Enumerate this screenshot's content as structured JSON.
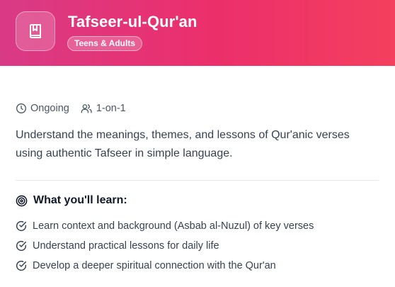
{
  "course": {
    "title": "Tafseer-ul-Qur'an",
    "audience_badge": "Teens & Adults",
    "icon": "book-icon",
    "accent_gradient": [
      "#d93a86",
      "#f43f5e"
    ]
  },
  "meta": {
    "duration_label": "Ongoing",
    "duration_icon": "clock-icon",
    "format_label": "1-on-1",
    "format_icon": "users-icon"
  },
  "description": "Understand the meanings, themes, and lessons of Qur'anic verses using authentic Tafseer in simple language.",
  "learn": {
    "heading": "What you'll learn:",
    "heading_icon": "target-icon",
    "items": [
      "Learn context and background (Asbab al-Nuzul) of key verses",
      "Understand practical lessons for daily life",
      "Develop a deeper spiritual connection with the Qur'an"
    ],
    "item_icon": "check-circle-icon"
  }
}
